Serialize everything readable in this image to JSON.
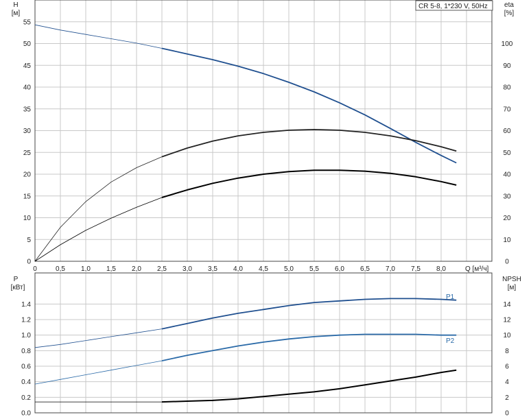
{
  "chart_data": [
    {
      "type": "line",
      "title": "CR 5-8, 1*230 V, 50Hz",
      "xlabel": "Q [м³/ч]",
      "x_ticks": [
        "0",
        "0,5",
        "1,0",
        "1,5",
        "2,0",
        "2,5",
        "3,0",
        "3,5",
        "4,0",
        "4,5",
        "5,0",
        "5,5",
        "6,0",
        "6,5",
        "7,0",
        "7,5",
        "8,0"
      ],
      "xlim": [
        0,
        9.0
      ],
      "left_axis": {
        "label_top": "H",
        "label_unit": "[м]",
        "ylim": [
          0,
          60
        ],
        "ticks": [
          "0",
          "5",
          "10",
          "15",
          "20",
          "25",
          "30",
          "35",
          "40",
          "45",
          "50",
          "55"
        ]
      },
      "right_axis": {
        "label_top": "eta",
        "label_unit": "[%]",
        "ylim": [
          0,
          120
        ],
        "ticks": [
          "0",
          "10",
          "20",
          "30",
          "40",
          "50",
          "60",
          "70",
          "80",
          "90",
          "100"
        ]
      },
      "grid": true,
      "series": [
        {
          "axis": "left",
          "color": "#1f4f8f",
          "x": [
            0,
            0.5,
            1.0,
            1.5,
            2.0,
            2.5,
            3.0,
            3.5,
            4.0,
            4.5,
            5.0,
            5.5,
            6.0,
            6.5,
            7.0,
            7.5,
            8.0,
            8.3
          ],
          "y": [
            54.3,
            53.1,
            52.1,
            51.1,
            50.1,
            48.9,
            47.6,
            46.3,
            44.8,
            43.1,
            41.1,
            38.9,
            36.4,
            33.6,
            30.5,
            27.3,
            24.3,
            22.6
          ]
        },
        {
          "axis": "right",
          "color": "#222222",
          "x": [
            0,
            0.5,
            1.0,
            1.5,
            2.0,
            2.5,
            3.0,
            3.5,
            4.0,
            4.5,
            5.0,
            5.5,
            6.0,
            6.5,
            7.0,
            7.5,
            8.0,
            8.3
          ],
          "y": [
            0,
            15.6,
            27.4,
            36.4,
            43.0,
            48.0,
            52.0,
            55.2,
            57.6,
            59.2,
            60.2,
            60.5,
            60.2,
            59.2,
            57.6,
            55.4,
            52.6,
            50.6
          ]
        },
        {
          "axis": "right",
          "color": "#000000",
          "x": [
            0,
            0.5,
            1.0,
            1.5,
            2.0,
            2.5,
            3.0,
            3.5,
            4.0,
            4.5,
            5.0,
            5.5,
            6.0,
            6.5,
            7.0,
            7.5,
            8.0,
            8.3
          ],
          "y": [
            0,
            7.6,
            14.2,
            19.8,
            24.8,
            29.3,
            32.8,
            35.8,
            38.2,
            40.0,
            41.2,
            41.8,
            41.8,
            41.4,
            40.4,
            38.8,
            36.6,
            35.0
          ]
        }
      ]
    },
    {
      "type": "line",
      "xlim": [
        0,
        9.0
      ],
      "left_axis": {
        "label_top": "P",
        "label_unit": "[кВт]",
        "ylim": [
          0,
          1.8
        ],
        "ticks": [
          "0.0",
          "0.2",
          "0.4",
          "0.6",
          "0.8",
          "1.0",
          "1.2",
          "1.4"
        ]
      },
      "right_axis": {
        "label_top": "NPSH",
        "label_unit": "[м]",
        "ylim": [
          0,
          18
        ],
        "ticks": [
          "0",
          "2",
          "4",
          "6",
          "8",
          "10",
          "12",
          "14"
        ]
      },
      "grid": true,
      "series": [
        {
          "name": "P1",
          "axis": "left",
          "color": "#1f4f8f",
          "x": [
            0,
            0.5,
            1.0,
            1.5,
            2.0,
            2.5,
            3.0,
            3.5,
            4.0,
            4.5,
            5.0,
            5.5,
            6.0,
            6.5,
            7.0,
            7.5,
            8.0,
            8.3
          ],
          "y": [
            0.84,
            0.88,
            0.93,
            0.98,
            1.03,
            1.08,
            1.15,
            1.22,
            1.28,
            1.33,
            1.38,
            1.42,
            1.44,
            1.46,
            1.47,
            1.47,
            1.46,
            1.45
          ]
        },
        {
          "name": "P2",
          "axis": "left",
          "color": "#2a6aa8",
          "x": [
            0,
            0.5,
            1.0,
            1.5,
            2.0,
            2.5,
            3.0,
            3.5,
            4.0,
            4.5,
            5.0,
            5.5,
            6.0,
            6.5,
            7.0,
            7.5,
            8.0,
            8.3
          ],
          "y": [
            0.37,
            0.43,
            0.49,
            0.55,
            0.61,
            0.67,
            0.74,
            0.8,
            0.86,
            0.91,
            0.95,
            0.98,
            1.0,
            1.01,
            1.01,
            1.01,
            1.0,
            1.0
          ]
        },
        {
          "axis": "right",
          "color": "#000000",
          "x": [
            0,
            0.5,
            1.0,
            1.5,
            2.0,
            2.5,
            3.0,
            3.5,
            4.0,
            4.5,
            5.0,
            5.5,
            6.0,
            6.5,
            7.0,
            7.5,
            8.0,
            8.3
          ],
          "y": [
            1.4,
            1.4,
            1.4,
            1.4,
            1.4,
            1.4,
            1.5,
            1.6,
            1.8,
            2.1,
            2.4,
            2.7,
            3.1,
            3.6,
            4.1,
            4.6,
            5.2,
            5.5
          ]
        }
      ]
    }
  ]
}
